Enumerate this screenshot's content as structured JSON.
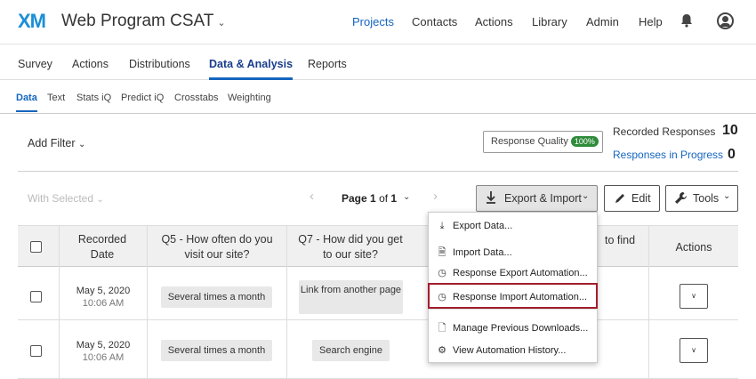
{
  "app": {
    "logo": "XM",
    "project": "Web Program CSAT"
  },
  "topnav": [
    "Projects",
    "Contacts",
    "Actions",
    "Library",
    "Admin",
    "Help"
  ],
  "tabs": [
    "Survey",
    "Actions",
    "Distributions",
    "Data & Analysis",
    "Reports"
  ],
  "subtabs": [
    "Data",
    "Text",
    "Stats iQ",
    "Predict iQ",
    "Crosstabs",
    "Weighting"
  ],
  "toolbar": {
    "add_filter": "Add Filter",
    "response_quality": "Response Quality",
    "rq_badge": "100%",
    "recorded_label": "Recorded Responses",
    "recorded_count": "10",
    "progress_label": "Responses in Progress",
    "progress_count": "0"
  },
  "actions": {
    "with_selected": "With Selected",
    "page_word": "Page",
    "page_num": "1",
    "of_word": "of",
    "page_total": "1",
    "export_import": "Export & Import",
    "edit": "Edit",
    "tools": "Tools"
  },
  "table": {
    "headers": {
      "date": "Recorded Date",
      "q5": "Q5 - How often do you visit our site?",
      "q7": "Q7 - How did you get to our site?",
      "q_partial": "to find",
      "actions": "Actions"
    },
    "rows": [
      {
        "date": "May 5, 2020",
        "time": "10:06 AM",
        "q5": "Several times a month",
        "q7": "Link from another page"
      },
      {
        "date": "May 5, 2020",
        "time": "10:06 AM",
        "q5": "Several times a month",
        "q7": "Search engine"
      }
    ]
  },
  "menu": [
    "Export Data...",
    "Import Data...",
    "Response Export Automation...",
    "Response Import Automation...",
    "Manage Previous Downloads...",
    "View Automation History..."
  ],
  "colors": {
    "accent": "#1565c0",
    "highlight": "#a31d2c",
    "badge": "#2e8b3a"
  }
}
